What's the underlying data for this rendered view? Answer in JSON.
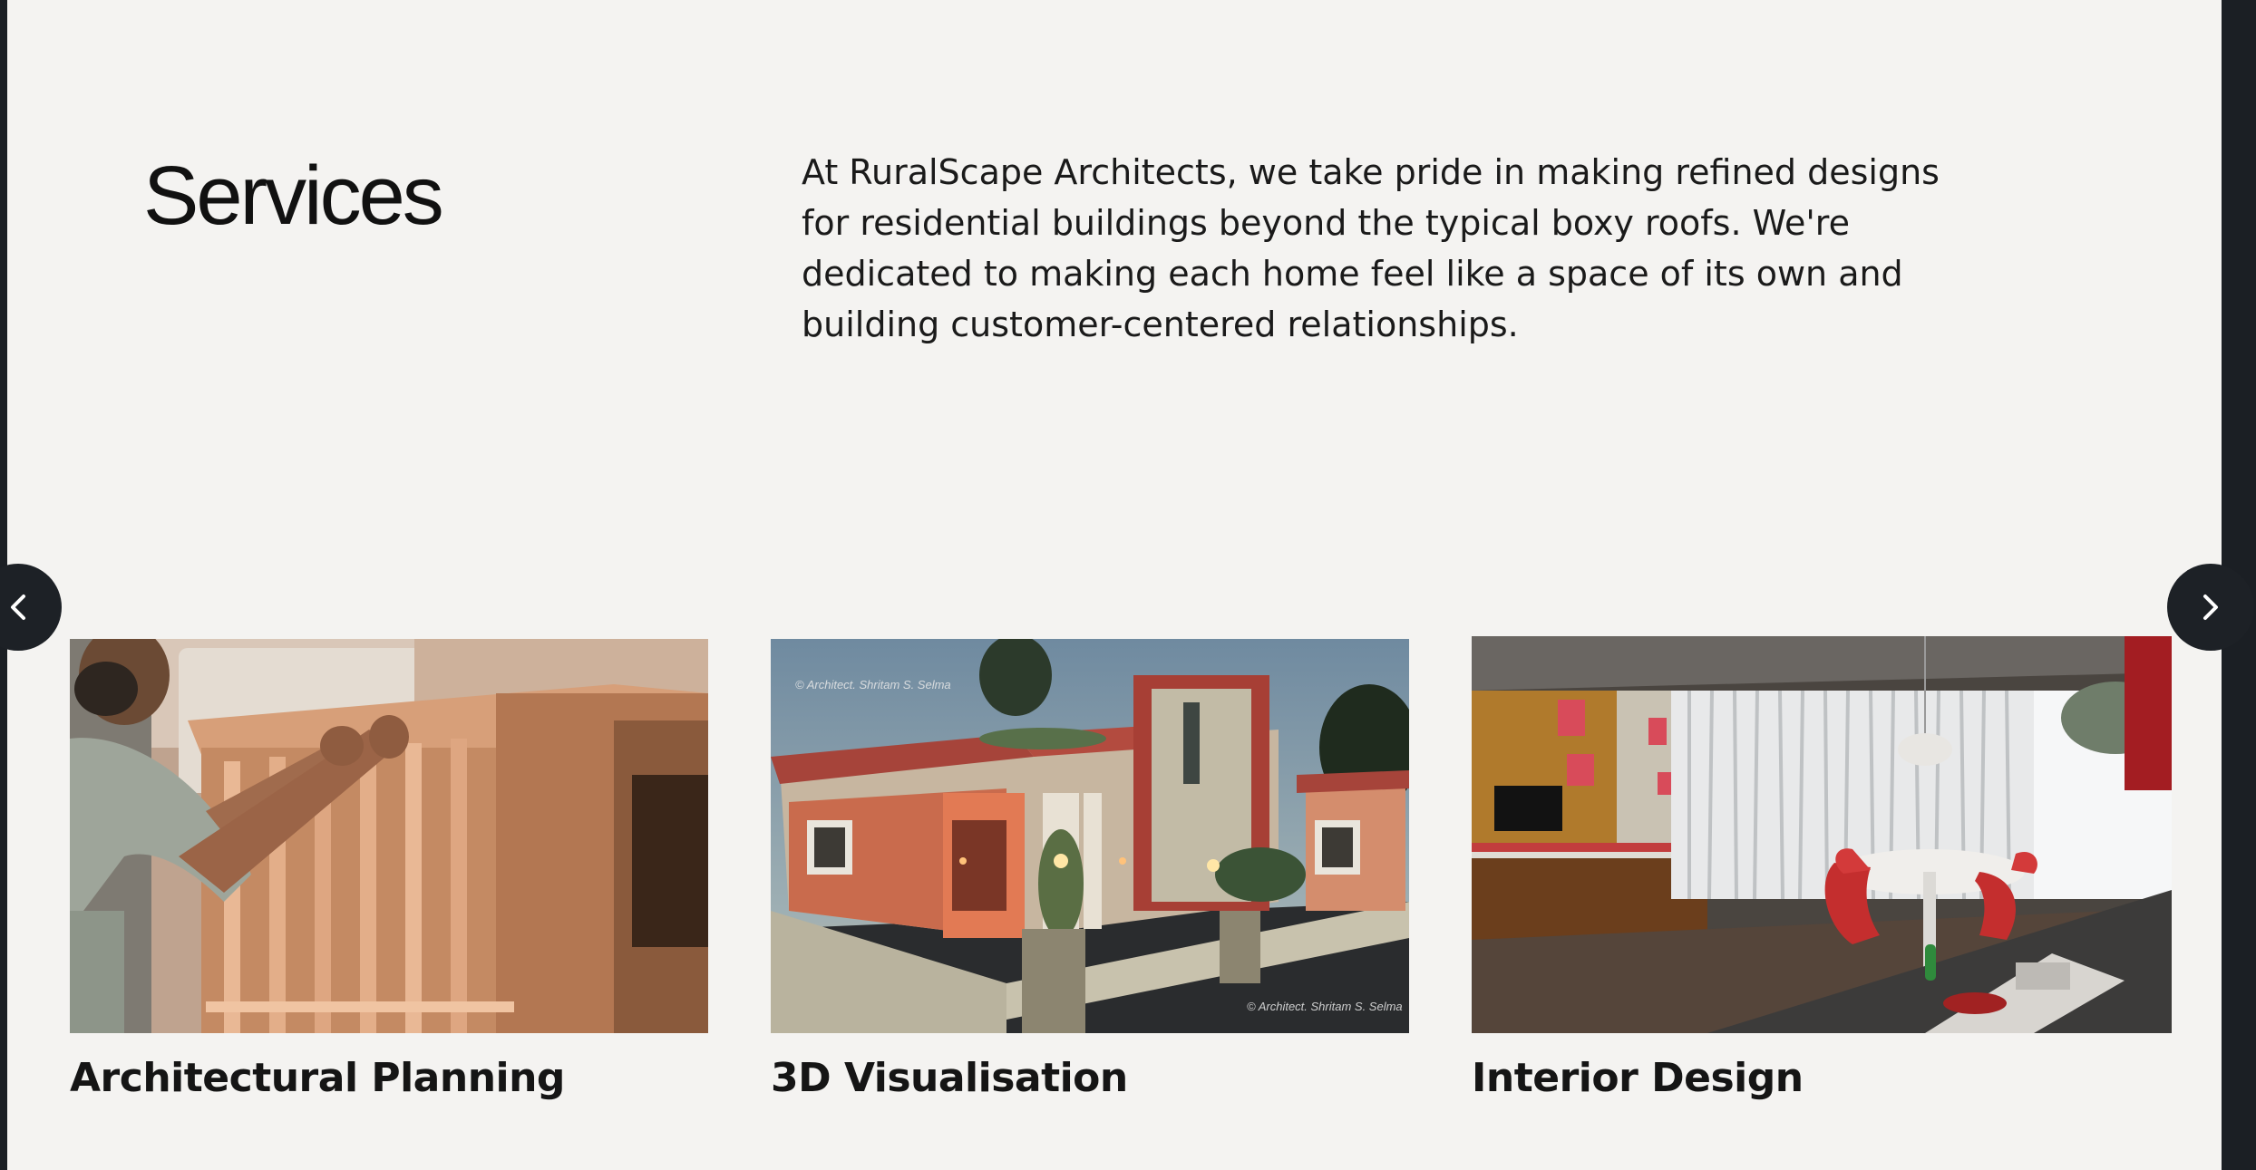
{
  "section": {
    "title": "Services",
    "intro": "At RuralScape Architects, we take pride in making refined designs for residential buildings beyond the typical boxy roofs. We're dedicated to making each home feel like a space of its own and building customer-centered relationships."
  },
  "carousel": {
    "prev_icon": "chevron-left-icon",
    "next_icon": "chevron-right-icon",
    "cards": [
      {
        "title": "Architectural Planning",
        "image": "carpenter-assembling-wooden-frame"
      },
      {
        "title": "3D Visualisation",
        "image": "rendered-house-exterior-at-dusk",
        "watermark": "© Architect. Shritam S. Selma"
      },
      {
        "title": "Interior Design",
        "image": "living-room-interior-render"
      }
    ]
  },
  "colors": {
    "page_bg": "#f4f3f1",
    "outer_bg": "#1b1f24",
    "button_bg": "#1d2126"
  }
}
